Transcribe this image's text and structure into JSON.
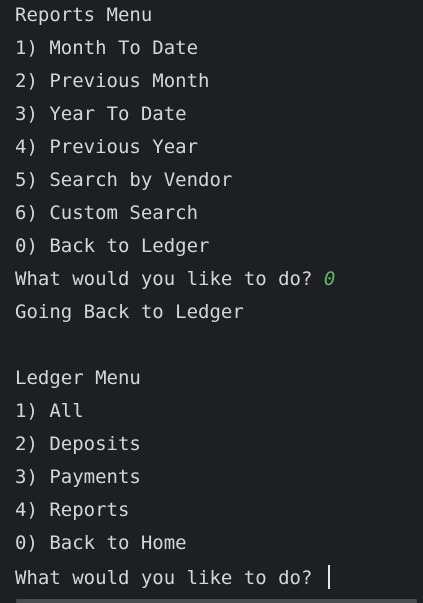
{
  "console": {
    "reports_menu": {
      "title": "Reports Menu",
      "items": [
        "1) Month To Date",
        "2) Previous Month",
        "3) Year To Date",
        "4) Previous Year",
        "5) Search by Vendor",
        "6) Custom Search",
        "0) Back to Ledger"
      ],
      "prompt": "What would you like to do? ",
      "input": "0",
      "response": "Going Back to Ledger"
    },
    "ledger_menu": {
      "title": "Ledger Menu",
      "items": [
        "1) All",
        "2) Deposits",
        "3) Payments",
        "4) Reports",
        "0) Back to Home"
      ],
      "prompt": "What would you like to do? "
    }
  },
  "colors": {
    "background": "#1e1f22",
    "text": "#d4d6dc",
    "user_input": "#5fb865"
  }
}
